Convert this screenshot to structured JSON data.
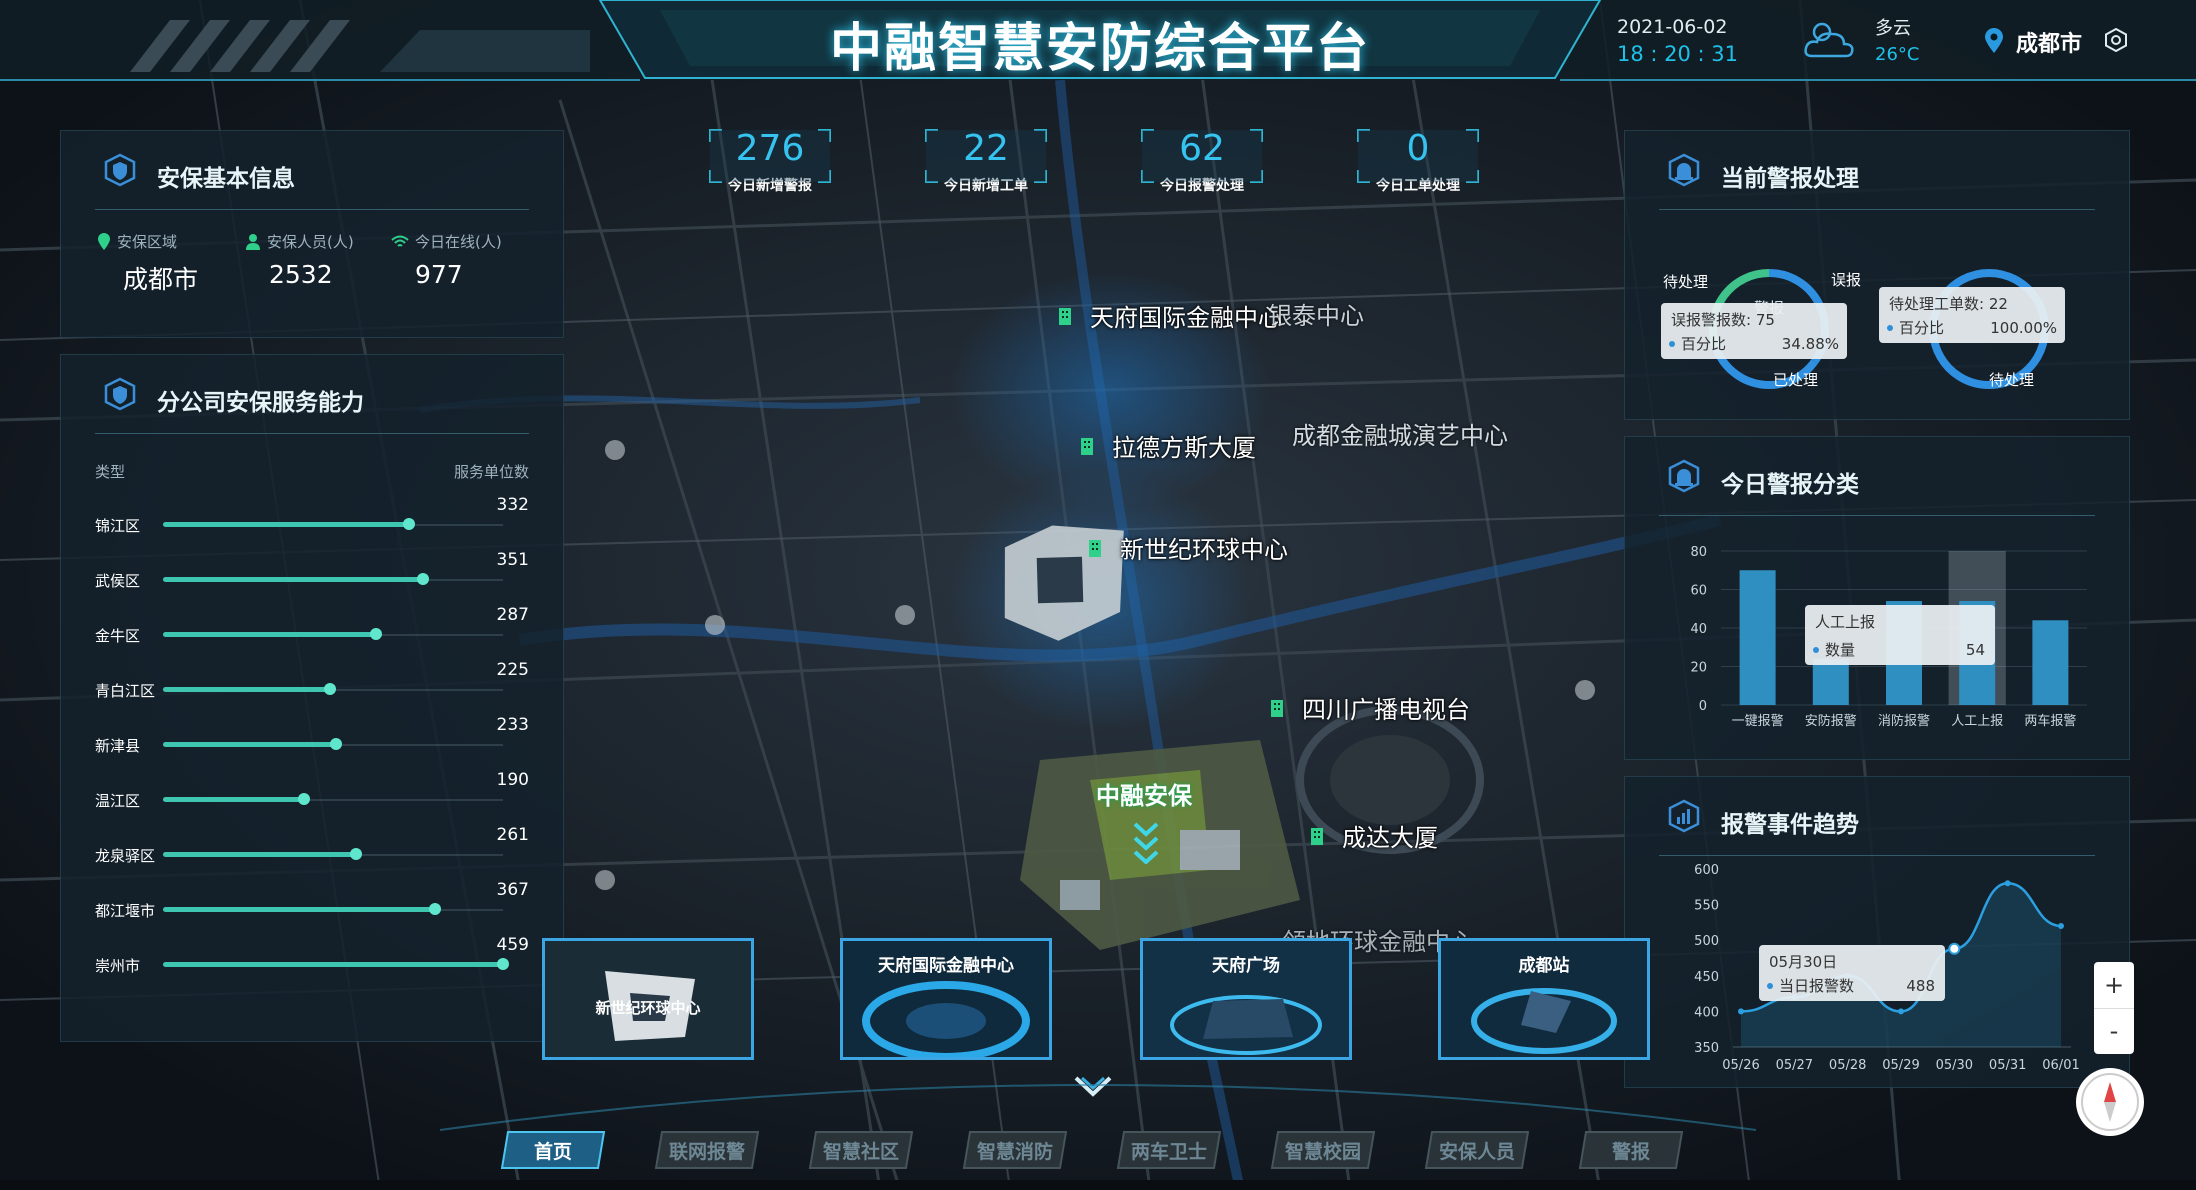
{
  "header": {
    "title": "中融智慧安防综合平台",
    "date": "2021-06-02",
    "time": "18 : 20 : 31",
    "weather": "多云",
    "temperature": "26°C",
    "city": "成都市"
  },
  "stats": [
    {
      "value": "276",
      "label": "今日新增警报"
    },
    {
      "value": "22",
      "label": "今日新增工单"
    },
    {
      "value": "62",
      "label": "今日报警处理"
    },
    {
      "value": "0",
      "label": "今日工单处理"
    }
  ],
  "basic_info": {
    "title": "安保基本信息",
    "area_label": "安保区域",
    "area_value": "成都市",
    "staff_label": "安保人员(人)",
    "staff_value": "2532",
    "online_label": "今日在线(人)",
    "online_value": "977"
  },
  "capability": {
    "title": "分公司安保服务能力",
    "col_type": "类型",
    "col_count": "服务单位数",
    "max": 459,
    "rows": [
      {
        "name": "锦江区",
        "value": 332
      },
      {
        "name": "武侯区",
        "value": 351
      },
      {
        "name": "金牛区",
        "value": 287
      },
      {
        "name": "青白江区",
        "value": 225
      },
      {
        "name": "新津县",
        "value": 233
      },
      {
        "name": "温江区",
        "value": 190
      },
      {
        "name": "龙泉驿区",
        "value": 261
      },
      {
        "name": "都江堰市",
        "value": 367
      },
      {
        "name": "崇州市",
        "value": 459
      }
    ]
  },
  "alarm_handling": {
    "title": "当前警报处理",
    "donut1": {
      "label_pending": "待处理",
      "label_false": "误报",
      "label_done": "已处理",
      "center": "警报",
      "tip_line1": "误报警报数: 75",
      "tip_pct_label": "百分比",
      "tip_pct_value": "34.88%",
      "fraction": 0.3488
    },
    "donut2": {
      "label_pending": "待处理",
      "tip_line1": "待处理工单数: 22",
      "tip_pct_label": "百分比",
      "tip_pct_value": "100.00%",
      "fraction": 1.0
    }
  },
  "alarm_category": {
    "title": "今日警报分类",
    "tooltip_title": "人工上报",
    "tooltip_key": "数量",
    "tooltip_value": "54"
  },
  "alarm_trend": {
    "title": "报警事件趋势",
    "tooltip_title": "05月30日",
    "tooltip_key": "当日报警数",
    "tooltip_value": "488"
  },
  "chart_data": [
    {
      "type": "bar",
      "categories": [
        "一键报警",
        "安防报警",
        "消防报警",
        "人工上报",
        "两车报警"
      ],
      "values": [
        70,
        24,
        54,
        54,
        44
      ],
      "ylim": [
        0,
        80
      ],
      "yticks": [
        0,
        20,
        40,
        60,
        80
      ],
      "highlight_index": 3,
      "color": "#2f8fc0"
    },
    {
      "type": "line",
      "x": [
        "05/26",
        "05/27",
        "05/28",
        "05/29",
        "05/30",
        "05/31",
        "06/01"
      ],
      "values": [
        400,
        420,
        450,
        400,
        488,
        580,
        520
      ],
      "ylim": [
        350,
        600
      ],
      "yticks": [
        350,
        400,
        450,
        500,
        550,
        600
      ],
      "color": "#2b9fe0"
    }
  ],
  "map": {
    "buildings": [
      "天府国际金融中心",
      "拉德方斯大厦",
      "新世纪环球中心",
      "四川广播电视台",
      "成达大厦"
    ],
    "faded_labels": [
      "银泰中心",
      "成都金融城演艺中心",
      "领地环球金融中心"
    ],
    "campus_label": "中融安保",
    "thumbnails": [
      "新世纪环球中心",
      "天府国际金融中心",
      "天府广场",
      "成都站"
    ]
  },
  "zoom": {
    "in": "+",
    "out": "-"
  },
  "nav": [
    "首页",
    "联网报警",
    "智慧社区",
    "智慧消防",
    "两车卫士",
    "智慧校园",
    "安保人员",
    "警报"
  ]
}
